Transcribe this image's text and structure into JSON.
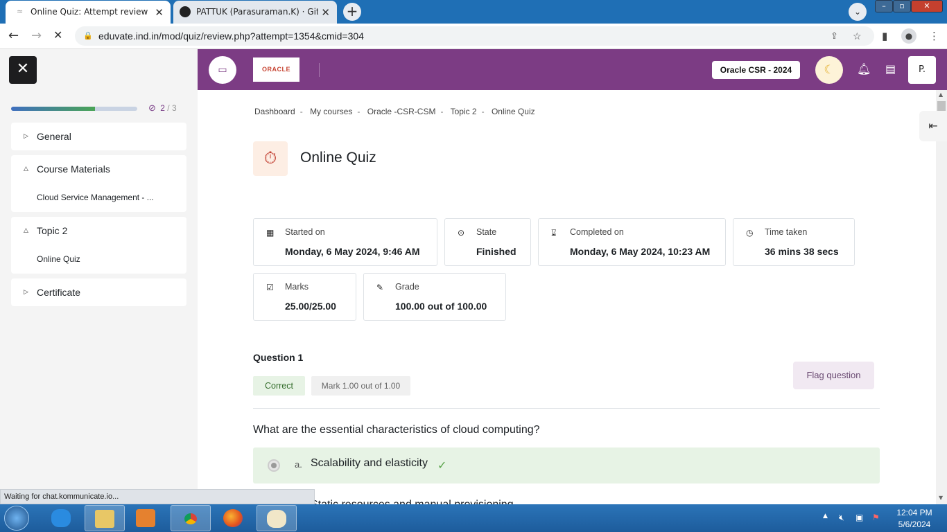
{
  "browser": {
    "tabs": [
      {
        "title": "Online Quiz: Attempt review",
        "active": true
      },
      {
        "title": "PATTUK (Parasuraman.K) · GitHub",
        "active": false
      }
    ],
    "url": "eduvate.ind.in/mod/quiz/review.php?attempt=1354&cmid=304"
  },
  "drawer": {
    "progress": {
      "completed": 2,
      "total_label": "/ 3",
      "fraction": 0.667
    },
    "sections": [
      {
        "title": "General",
        "expanded": false,
        "items": []
      },
      {
        "title": "Course Materials",
        "expanded": true,
        "items": [
          "Cloud Service Management - ..."
        ]
      },
      {
        "title": "Topic 2",
        "expanded": true,
        "items": [
          "Online Quiz"
        ]
      },
      {
        "title": "Certificate",
        "expanded": false,
        "items": []
      }
    ]
  },
  "header": {
    "logo_text": "ORACLE",
    "course_name": "Oracle CSR - 2024",
    "avatar_initial": "P."
  },
  "breadcrumb": [
    "Dashboard",
    "My courses",
    "Oracle -CSR-CSM",
    "Topic 2",
    "Online Quiz"
  ],
  "page_title": "Online Quiz",
  "summary": {
    "started": {
      "label": "Started on",
      "value": "Monday, 6 May 2024, 9:46 AM"
    },
    "state": {
      "label": "State",
      "value": "Finished"
    },
    "completed": {
      "label": "Completed on",
      "value": "Monday, 6 May 2024, 10:23 AM"
    },
    "time_taken": {
      "label": "Time taken",
      "value": "36 mins 38 secs"
    },
    "marks": {
      "label": "Marks",
      "value": "25.00/25.00"
    },
    "grade": {
      "label": "Grade",
      "value": "100.00 out of 100.00"
    }
  },
  "question": {
    "title": "Question 1",
    "status": "Correct",
    "mark": "Mark 1.00 out of 1.00",
    "flag_label": "Flag question",
    "text": "What are the essential characteristics of cloud computing?",
    "answers": [
      {
        "letter": "a.",
        "text": "Scalability and elasticity",
        "correct": true
      },
      {
        "letter": "b.",
        "text": "Static resources and manual provisioning",
        "correct": false
      }
    ]
  },
  "status_text": "Waiting for chat.kommunicate.io...",
  "taskbar": {
    "time": "12:04 PM",
    "date": "5/6/2024"
  },
  "colors": {
    "brand": "#7c3c84",
    "correct_bg": "#e7f3e5",
    "progress": "#4aa456"
  }
}
